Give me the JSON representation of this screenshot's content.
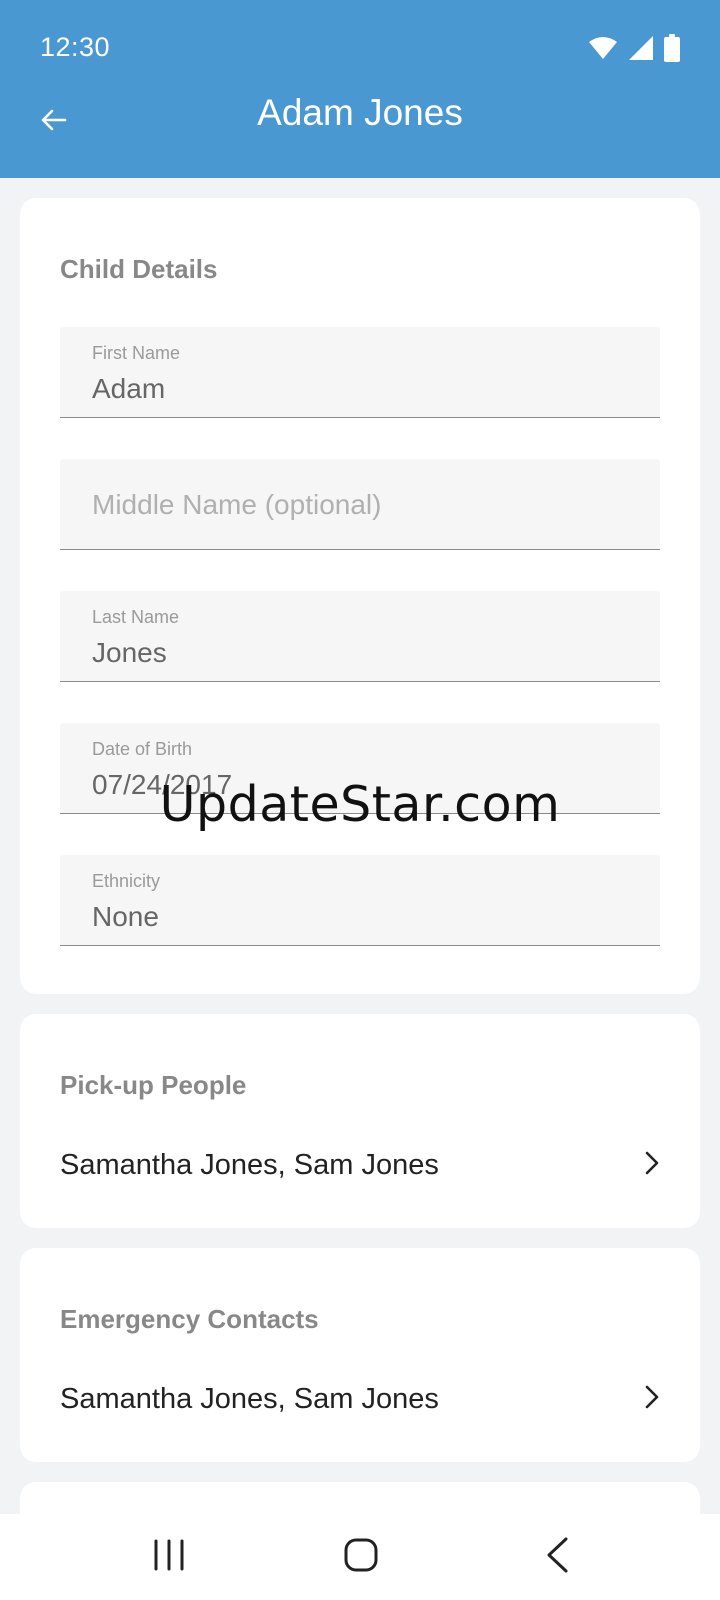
{
  "status_bar": {
    "time": "12:30",
    "icons": [
      "wifi-icon",
      "signal-icon",
      "battery-icon"
    ]
  },
  "app_bar": {
    "title": "Adam Jones",
    "back_icon": "arrow-left-icon",
    "color": "#4a98d2"
  },
  "child_details": {
    "title": "Child Details",
    "first_name": {
      "label": "First Name",
      "value": "Adam"
    },
    "middle_name": {
      "placeholder": "Middle Name (optional)"
    },
    "last_name": {
      "label": "Last Name",
      "value": "Jones"
    },
    "date_of_birth": {
      "label": "Date of Birth",
      "value": "07/24/2017"
    },
    "ethnicity": {
      "label": "Ethnicity",
      "value": "None"
    }
  },
  "pickup_people": {
    "title": "Pick-up People",
    "value": "Samantha Jones, Sam Jones"
  },
  "emergency_contacts": {
    "title": "Emergency Contacts",
    "value": "Samantha Jones, Sam Jones"
  },
  "watermark": "UpdateStar.com",
  "nav_bar": {
    "icons": [
      "recent-apps-icon",
      "home-icon",
      "back-icon"
    ]
  }
}
